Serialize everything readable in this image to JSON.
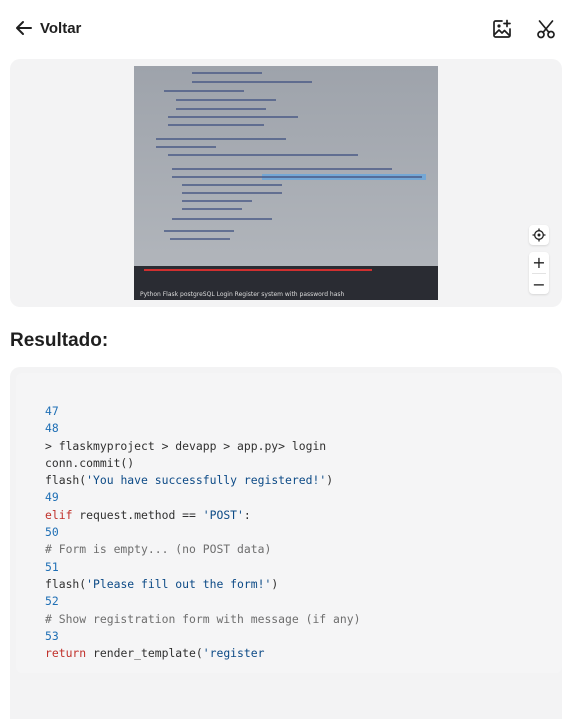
{
  "header": {
    "back_label": "Voltar",
    "icons": [
      "arrow-left-icon",
      "add-image-icon",
      "scissors-icon"
    ]
  },
  "image_viewer": {
    "caption": "Python Flask postgreSQL Login Register system with password hash",
    "zoom_in_label": "+",
    "zoom_out_label": "−"
  },
  "result": {
    "title": "Resultado:",
    "lines": [
      {
        "kind": "ln",
        "text": "47"
      },
      {
        "kind": "ln",
        "text": "48"
      },
      {
        "kind": "plain",
        "text": "> flaskmyproject > devapp > app.py> login"
      },
      {
        "kind": "plain",
        "text": "conn.commit()"
      },
      {
        "kind": "flash1",
        "pre": "flash(",
        "str": "'You have successfully registered!'",
        "post": ")"
      },
      {
        "kind": "ln",
        "text": "49"
      },
      {
        "kind": "elif",
        "kw": "elif",
        "pre": " request.method == ",
        "str": "'POST'",
        "post": ":"
      },
      {
        "kind": "ln",
        "text": "50"
      },
      {
        "kind": "cm",
        "text": "# Form is empty... (no POST data)"
      },
      {
        "kind": "ln",
        "text": "51"
      },
      {
        "kind": "flash2",
        "pre": "flash(",
        "str": "'Please fill out the form!'",
        "post": ")"
      },
      {
        "kind": "ln",
        "text": "52"
      },
      {
        "kind": "cm",
        "text": "# Show registration form with message (if any)"
      },
      {
        "kind": "ln",
        "text": "53"
      },
      {
        "kind": "ret",
        "kw": "return",
        "pre": " render_template(",
        "str": "'register"
      }
    ]
  },
  "colors": {
    "line_number": "#1f6fb5",
    "keyword": "#c0302a",
    "string": "#0c4a86",
    "comment": "#6e6e6e",
    "card_bg": "#f3f3f4"
  }
}
